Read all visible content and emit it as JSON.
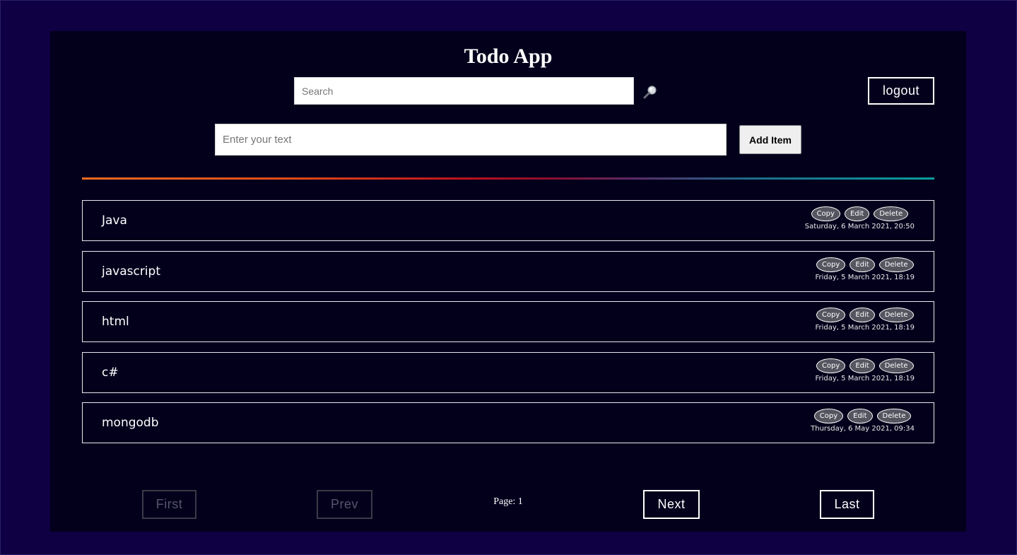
{
  "app": {
    "title": "Todo App"
  },
  "search": {
    "placeholder": "Search",
    "value": ""
  },
  "header": {
    "logout_label": "logout"
  },
  "add_form": {
    "placeholder": "Enter your text",
    "value": "",
    "add_label": "Add Item"
  },
  "todos": [
    {
      "text": "Java",
      "date": "Saturday, 6 March 2021, 20:50",
      "copy_label": "Copy",
      "edit_label": "Edit",
      "delete_label": "Delete"
    },
    {
      "text": "javascript",
      "date": "Friday, 5 March 2021, 18:19",
      "copy_label": "Copy",
      "edit_label": "Edit",
      "delete_label": "Delete"
    },
    {
      "text": "html",
      "date": "Friday, 5 March 2021, 18:19",
      "copy_label": "Copy",
      "edit_label": "Edit",
      "delete_label": "Delete"
    },
    {
      "text": "c#",
      "date": "Friday, 5 March 2021, 18:19",
      "copy_label": "Copy",
      "edit_label": "Edit",
      "delete_label": "Delete"
    },
    {
      "text": "mongodb",
      "date": "Thursday, 6 May 2021, 09:34",
      "copy_label": "Copy",
      "edit_label": "Edit",
      "delete_label": "Delete"
    }
  ],
  "pagination": {
    "first_label": "First",
    "prev_label": "Prev",
    "page_text": "Page: 1",
    "next_label": "Next",
    "last_label": "Last"
  },
  "colors": {
    "page_bg": "#0e0042",
    "panel_bg": "#03001c",
    "divider_start": "#f36b21",
    "divider_end": "#0a9da0"
  },
  "icons": {
    "search": "search-icon"
  }
}
